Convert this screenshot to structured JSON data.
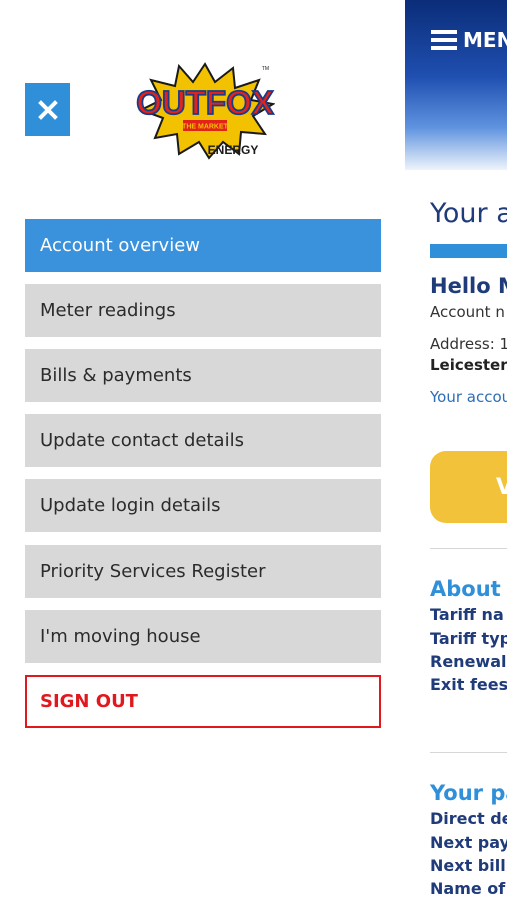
{
  "header": {
    "menu_label": "MENU"
  },
  "page": {
    "title": "Your a",
    "greeting": "Hello M",
    "account_number_label": "Account n",
    "address": "Address: 1",
    "region": "Leicesters",
    "account_link": "Your accou",
    "primary_button_label": "V"
  },
  "about": {
    "title": "About",
    "rows": [
      "Tariff na",
      "Tariff typ",
      "Renewal",
      "Exit fees"
    ]
  },
  "payments": {
    "title": "Your pa",
    "rows": [
      "Direct de",
      "Next pay",
      "Next bill",
      "Name of"
    ]
  },
  "drawer": {
    "logo": {
      "top_text": "OUTFOX",
      "middle_text": "THE MARKET",
      "bottom_text": "ENERGY",
      "tm": "TM"
    },
    "items": [
      {
        "label": "Account overview",
        "active": true
      },
      {
        "label": "Meter readings",
        "active": false
      },
      {
        "label": "Bills & payments",
        "active": false
      },
      {
        "label": "Update contact details",
        "active": false
      },
      {
        "label": "Update login details",
        "active": false
      },
      {
        "label": "Priority Services Register",
        "active": false
      },
      {
        "label": "I'm moving house",
        "active": false
      }
    ],
    "sign_out_label": "SIGN OUT"
  },
  "icons": [
    "close-icon",
    "hamburger-menu-icon",
    "outfox-logo"
  ],
  "colors": {
    "accent": "#3a92dc",
    "sign_out": "#e0191f",
    "nav_bg": "#d8d8d8",
    "header_dark": "#0b2d79",
    "button_yellow": "#f2c23a"
  }
}
